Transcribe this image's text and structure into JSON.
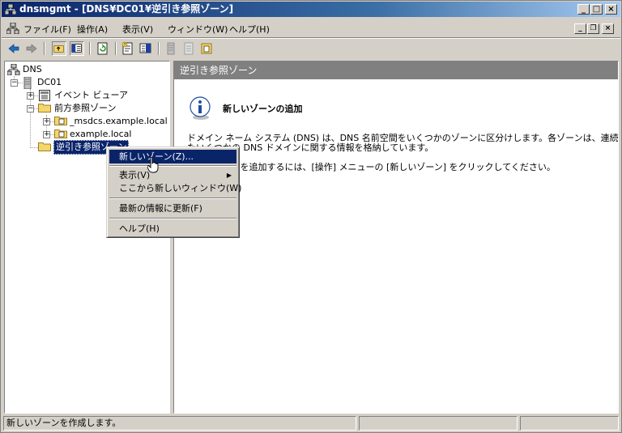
{
  "window": {
    "title": "dnsmgmt - [DNS¥DC01¥逆引き参照ゾーン]",
    "min_glyph": "_",
    "max_glyph": "□",
    "close_glyph": "×",
    "mdi_restore_glyph": "❐"
  },
  "menubar": {
    "items": [
      "ファイル(F)",
      "操作(A)",
      "表示(V)",
      "ウィンドウ(W)",
      "ヘルプ(H)"
    ]
  },
  "toolbar": {
    "icons": [
      "back-arrow-icon",
      "forward-arrow-icon",
      "up-folder-icon",
      "show-hide-tree-icon",
      "refresh-icon",
      "properties-icon",
      "help-icon",
      "server-icon",
      "document-icon",
      "zone-icon"
    ]
  },
  "tree": {
    "root": "DNS",
    "server": "DC01",
    "event_viewer": "イベント ビューア",
    "forward_zones": "前方参照ゾーン",
    "msdcs_zone": "_msdcs.example.local",
    "example_zone": "example.local",
    "reverse_zones": "逆引き参照ゾーン",
    "plus": "+",
    "minus": "−"
  },
  "context_menu": {
    "items": [
      {
        "label": "新しいゾーン(Z)...",
        "highlighted": true
      },
      {
        "label": "表示(V)",
        "submenu_arrow": "▶"
      },
      {
        "label": "ここから新しいウィンドウ(W)"
      },
      {
        "label": "最新の情報に更新(F)"
      },
      {
        "label": "ヘルプ(H)"
      }
    ]
  },
  "right_pane": {
    "header": "逆引き参照ゾーン",
    "title": "新しいゾーンの追加",
    "line1": "ドメイン ネーム システム (DNS) は、DNS 名前空間をいくつかのゾーンに区分けします。各ゾーンは、連続し",
    "line2": "たいくつかの DNS ドメインに関する情報を格納しています。",
    "line3": "新しいゾーンを追加するには、[操作] メニューの [新しいゾーン] をクリックしてください。"
  },
  "statusbar": {
    "text": "新しいゾーンを作成します。"
  },
  "colors": {
    "title_active": "#0a246a",
    "face": "#d4d0c8",
    "highlight": "#0a246a",
    "header_gray": "#808080"
  }
}
